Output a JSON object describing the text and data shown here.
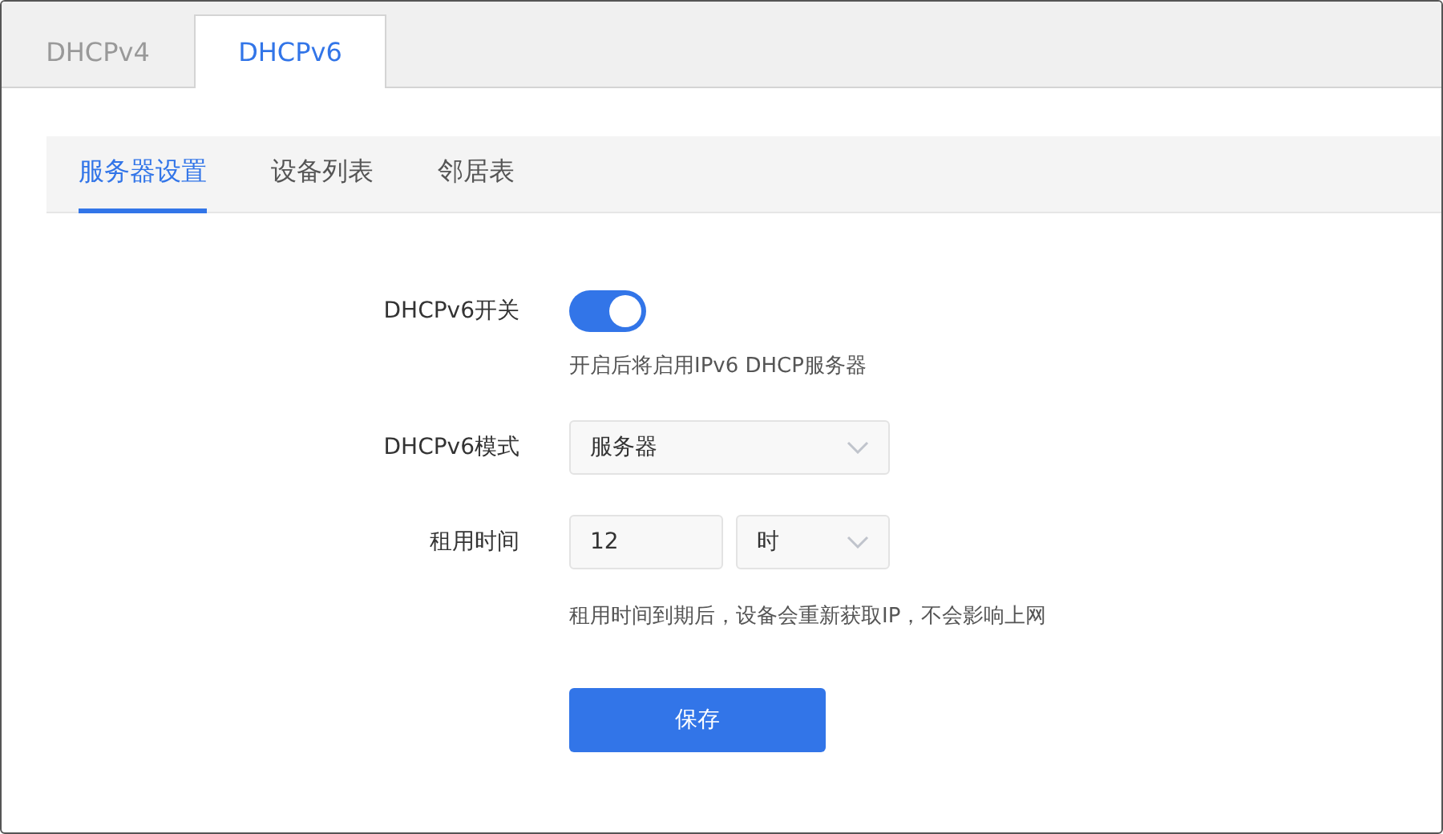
{
  "tabs": [
    {
      "label": "DHCPv4",
      "selected": false
    },
    {
      "label": "DHCPv6",
      "selected": true
    }
  ],
  "subtabs": [
    {
      "label": "服务器设置",
      "selected": true
    },
    {
      "label": "设备列表",
      "selected": false
    },
    {
      "label": "邻居表",
      "selected": false
    }
  ],
  "form": {
    "fields": [
      {
        "kind": "toggle",
        "label": "DHCPv6开关",
        "on": true,
        "hint": "开启后将启用IPv6 DHCP服务器"
      },
      {
        "kind": "select",
        "label": "DHCPv6模式",
        "value": "服务器"
      },
      {
        "kind": "number_unit",
        "label": "租用时间",
        "value": "12",
        "unit": "时",
        "hint": "租用时间到期后，设备会重新获取IP，不会影响上网"
      }
    ],
    "save_button": "保存"
  }
}
